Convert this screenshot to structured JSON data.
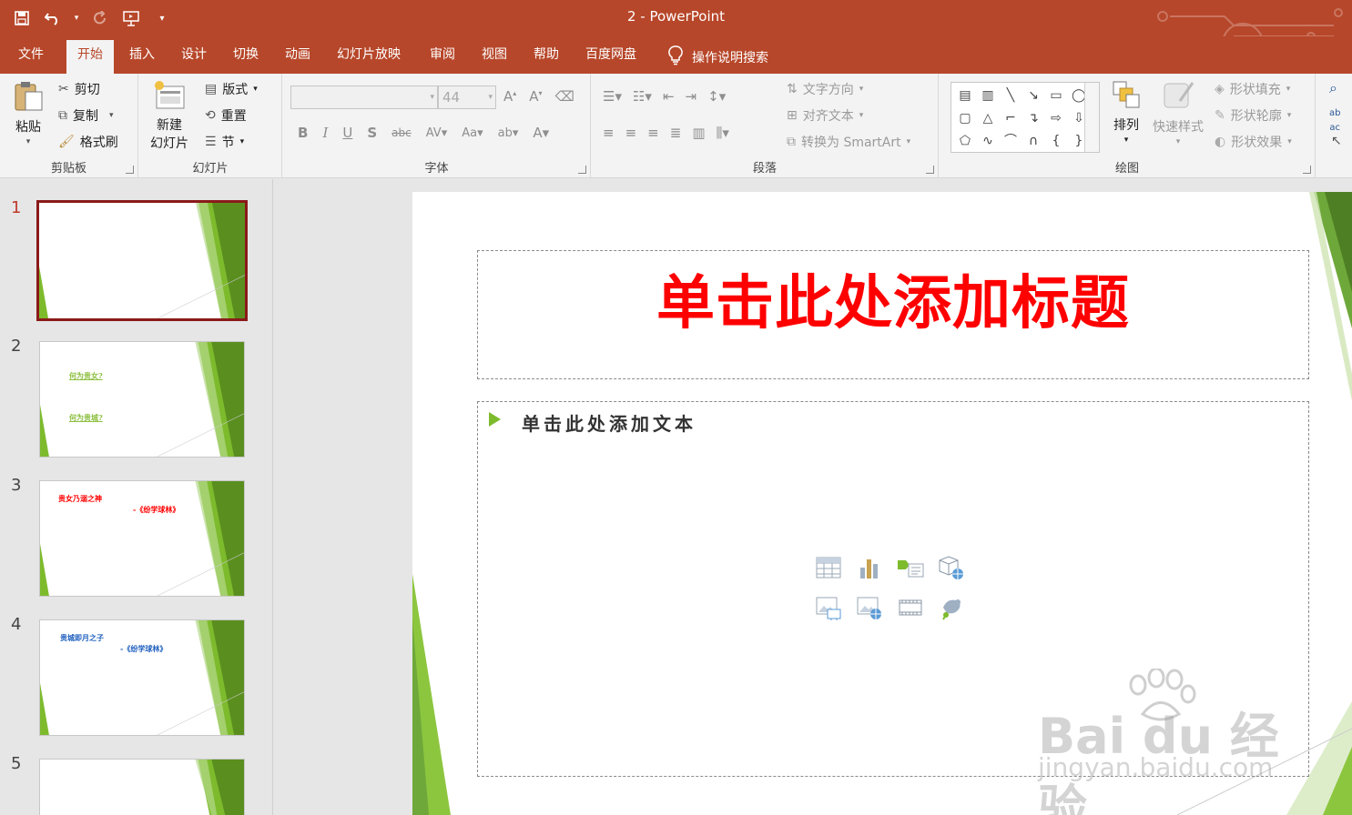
{
  "window": {
    "title": "2  -  PowerPoint"
  },
  "qat": {
    "save": "save-icon",
    "undo": "undo-icon",
    "redo": "redo-icon",
    "present": "presentation-icon",
    "more": "▾"
  },
  "tabs": [
    {
      "label": "文件"
    },
    {
      "label": "开始"
    },
    {
      "label": "插入"
    },
    {
      "label": "设计"
    },
    {
      "label": "切换"
    },
    {
      "label": "动画"
    },
    {
      "label": "幻灯片放映"
    },
    {
      "label": "审阅"
    },
    {
      "label": "视图"
    },
    {
      "label": "帮助"
    },
    {
      "label": "百度网盘"
    }
  ],
  "search_label": "操作说明搜索",
  "ribbon": {
    "clipboard": {
      "label": "剪贴板",
      "paste": "粘贴",
      "cut": "剪切",
      "copy": "复制",
      "format_painter": "格式刷"
    },
    "slides": {
      "label": "幻灯片",
      "new_slide_1": "新建",
      "new_slide_2": "幻灯片",
      "layout": "版式",
      "reset": "重置",
      "section": "节"
    },
    "font": {
      "label": "字体",
      "font_size": "44"
    },
    "paragraph": {
      "label": "段落",
      "text_direction": "文字方向",
      "align_text": "对齐文本",
      "smartart": "转换为 SmartArt"
    },
    "drawing": {
      "label": "绘图",
      "arrange": "排列",
      "quick_styles": "快速样式",
      "shape_fill": "形状填充",
      "shape_outline": "形状轮廓",
      "shape_effects": "形状效果"
    }
  },
  "slides_panel": [
    {
      "num": "1",
      "lines": []
    },
    {
      "num": "2",
      "lines": [
        "何为贵女?",
        "何为贵城?"
      ]
    },
    {
      "num": "3",
      "lines": [
        "贵女乃溺之神",
        "-《纷学球林》"
      ]
    },
    {
      "num": "4",
      "lines": [
        "贵城即月之子",
        "-《纷学球林》"
      ]
    },
    {
      "num": "5",
      "lines": []
    }
  ],
  "slide": {
    "title_placeholder": "单击此处添加标题",
    "body_placeholder": "单击此处添加文本"
  },
  "watermark": {
    "big": "Bai du 经验",
    "small": "jingyan.baidu.com"
  },
  "colors": {
    "accent": "#b7472a",
    "green": "#7dbb2d",
    "title_red": "#ff0000"
  }
}
